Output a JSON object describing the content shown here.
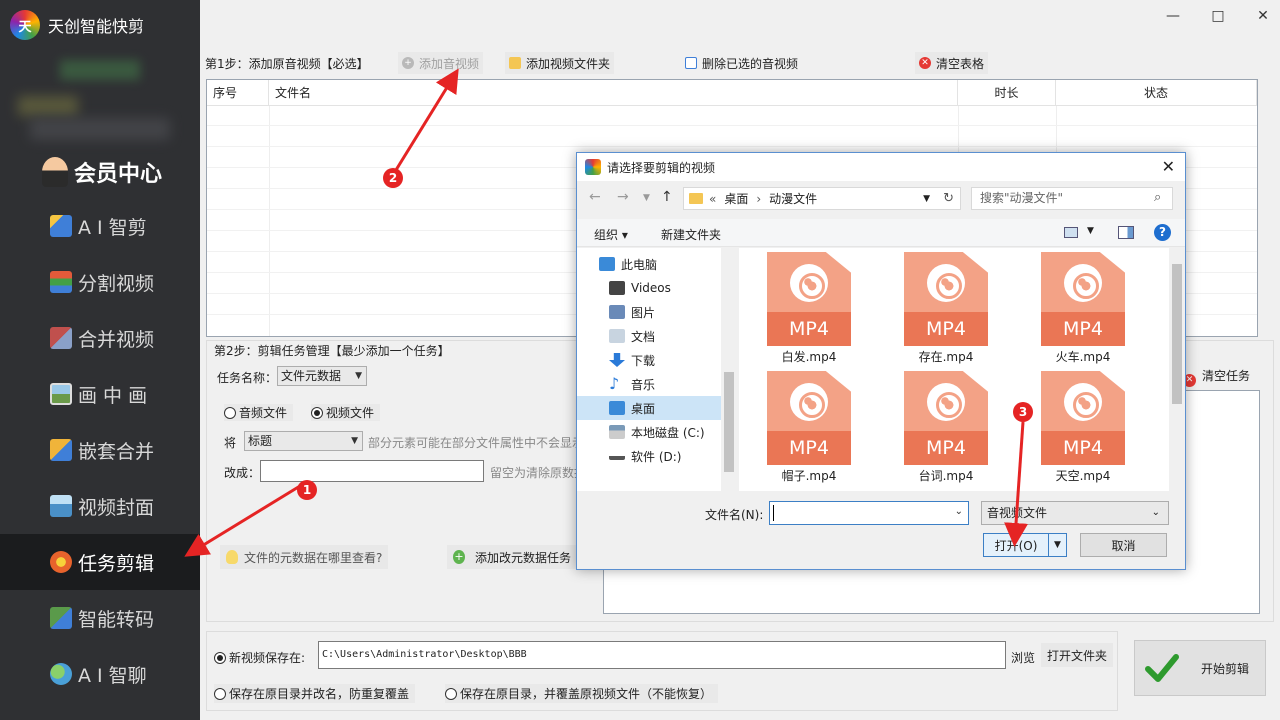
{
  "app": {
    "title": "天创智能快剪",
    "logo_text": "天"
  },
  "member": {
    "label": "会员中心"
  },
  "sidebar": {
    "items": [
      {
        "label": "A I 智剪",
        "icon": "ai-cut-icon",
        "color": "#3f7fd8"
      },
      {
        "label": "分割视频",
        "icon": "split-video-icon",
        "color": "#e45a3a"
      },
      {
        "label": "合并视频",
        "icon": "merge-video-icon",
        "color": "#c0504d"
      },
      {
        "label": "画 中 画",
        "icon": "pip-icon",
        "color": "#6aa0d8"
      },
      {
        "label": "嵌套合并",
        "icon": "nest-merge-icon",
        "color": "#f0b43a"
      },
      {
        "label": "视频封面",
        "icon": "video-cover-icon",
        "color": "#4a90c8"
      },
      {
        "label": "任务剪辑",
        "icon": "task-edit-icon",
        "color": "#e8632c",
        "active": true
      },
      {
        "label": "智能转码",
        "icon": "transcode-icon",
        "color": "#5a9a4a"
      },
      {
        "label": "A I 智聊",
        "icon": "ai-chat-icon",
        "color": "#4aa0d8"
      }
    ]
  },
  "window": {
    "minimize": "—",
    "maximize": "□",
    "close": "✕"
  },
  "step1": {
    "label": "第1步：添加原音视频【必选】",
    "add_audio_video": "添加音视频",
    "add_folder": "添加视频文件夹",
    "delete_selected": "删除已选的音视频",
    "clear_table": "清空表格"
  },
  "grid": {
    "columns": [
      "序号",
      "文件名",
      "时长",
      "状态"
    ]
  },
  "step2": {
    "label": "第2步：剪辑任务管理【最少添加一个任务】",
    "task_name_label": "任务名称：",
    "task_name_value": "文件元数据",
    "audio_file": "音频文件",
    "video_file": "视频文件",
    "field_prefix": "将",
    "field_value": "标题",
    "field_note": "部分元素可能在部分文件属性中不会显示",
    "change_to_label": "改成：",
    "change_to_value": "",
    "change_note": "留空为清除原数据",
    "help_link": "文件的元数据在哪里查看?",
    "add_task": "添加改元数据任务",
    "clear_task": "清空任务"
  },
  "output": {
    "save_label": "新视频保存在:",
    "save_path": "C:\\Users\\Administrator\\Desktop\\BBB",
    "browse": "浏览",
    "open_folder": "打开文件夹",
    "rename_option": "保存在原目录并改名，防重复覆盖",
    "overwrite_option": "保存在原目录，并覆盖原视频文件（不能恢复）",
    "start": "开始剪辑"
  },
  "dialog": {
    "title": "请选择要剪辑的视频",
    "path": [
      "«",
      "桌面",
      "›",
      "动漫文件"
    ],
    "search_placeholder": "搜索\"动漫文件\"",
    "organize": "组织 ▾",
    "new_folder": "新建文件夹",
    "tree": [
      {
        "label": "此电脑",
        "icon": "computer-icon",
        "color": "#3a8ad8"
      },
      {
        "label": "Videos",
        "icon": "videos-folder-icon",
        "color": "#555555"
      },
      {
        "label": "图片",
        "icon": "pictures-folder-icon",
        "color": "#6a8ab8"
      },
      {
        "label": "文档",
        "icon": "documents-folder-icon",
        "color": "#8aa0b8"
      },
      {
        "label": "下载",
        "icon": "downloads-folder-icon",
        "color": "#2a7ad8"
      },
      {
        "label": "音乐",
        "icon": "music-folder-icon",
        "color": "#2a7ad8"
      },
      {
        "label": "桌面",
        "icon": "desktop-folder-icon",
        "color": "#3a8ad8",
        "selected": true
      },
      {
        "label": "本地磁盘 (C:)",
        "icon": "local-disk-icon",
        "color": "#7a9ab8"
      },
      {
        "label": "软件 (D:)",
        "icon": "drive-icon",
        "color": "#666666"
      }
    ],
    "files": [
      {
        "name": "白发.mp4",
        "badge": "MP4"
      },
      {
        "name": "存在.mp4",
        "badge": "MP4"
      },
      {
        "name": "火车.mp4",
        "badge": "MP4"
      },
      {
        "name": "帽子.mp4",
        "badge": "MP4"
      },
      {
        "name": "台词.mp4",
        "badge": "MP4"
      },
      {
        "name": "天空.mp4",
        "badge": "MP4"
      }
    ],
    "filename_label": "文件名(N):",
    "filename_value": "",
    "filetype": "音视频文件",
    "open": "打开(O)",
    "cancel": "取消"
  },
  "annotations": {
    "badge1": "1",
    "badge2": "2",
    "badge3": "3",
    "color": "#e52424"
  }
}
